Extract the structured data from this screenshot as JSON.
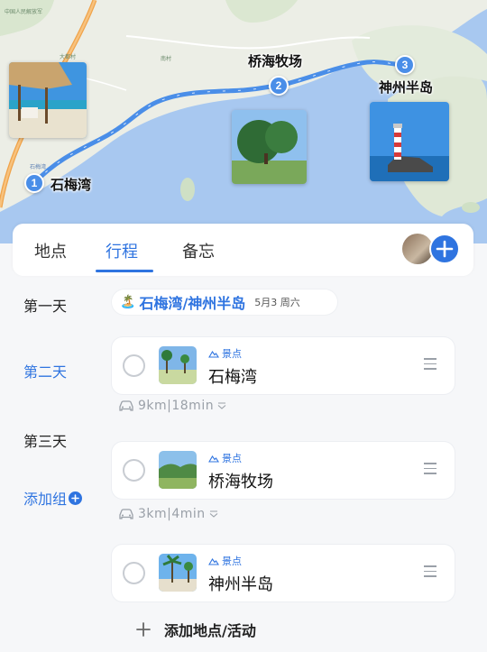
{
  "map": {
    "stops": [
      {
        "num": "1",
        "name": "石梅湾"
      },
      {
        "num": "2",
        "name": "桥海牧场"
      },
      {
        "num": "3",
        "name": "神州半岛"
      }
    ],
    "labels": [
      "中国人民解放军",
      "石梅湾",
      "大都村",
      "南村"
    ]
  },
  "tabs": [
    {
      "label": "地点"
    },
    {
      "label": "行程"
    },
    {
      "label": "备忘"
    }
  ],
  "days": [
    "第一天",
    "第二天",
    "第三天"
  ],
  "add_group": "添加组",
  "day_header": {
    "emoji": "🏝️",
    "route": "石梅湾/神州半岛",
    "date": "5月3 周六"
  },
  "items": [
    {
      "type": "景点",
      "name": "石梅湾"
    },
    {
      "type": "景点",
      "name": "桥海牧场"
    },
    {
      "type": "景点",
      "name": "神州半岛"
    }
  ],
  "transits": [
    {
      "text": "9km|18min"
    },
    {
      "text": "3km|4min"
    }
  ],
  "add_place": "添加地点/活动",
  "colors": {
    "accent": "#2f74e0",
    "route": "#4a8ee8",
    "sea": "#a8c8f0"
  }
}
